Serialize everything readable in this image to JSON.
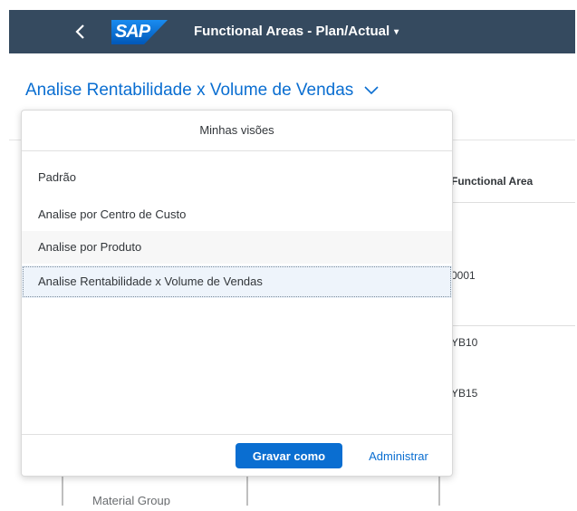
{
  "shell": {
    "back_icon": "chevron-left-icon",
    "logo": "SAP",
    "app_title": "Functional Areas - Plan/Actual",
    "app_title_caret": "▾",
    "colors": {
      "shell_bg": "#354a5f",
      "accent": "#0a6ed1"
    }
  },
  "header": {
    "view_title": "Analise Rentabilidade x Volume de Vendas"
  },
  "table": {
    "column_header": "Functional Area",
    "cells": [
      "0001",
      "YB10",
      "YB15"
    ],
    "row_label": "Material Group"
  },
  "views_popover": {
    "title": "Minhas visões",
    "items": [
      {
        "label": "Padrão"
      },
      {
        "label": "Analise por Centro de Custo"
      },
      {
        "label": "Analise por Produto"
      },
      {
        "label": "Analise Rentabilidade x Volume de Vendas"
      }
    ],
    "selected_item": "Analise Rentabilidade x Volume de Vendas",
    "save_as_label": "Gravar como",
    "manage_label": "Administrar"
  }
}
